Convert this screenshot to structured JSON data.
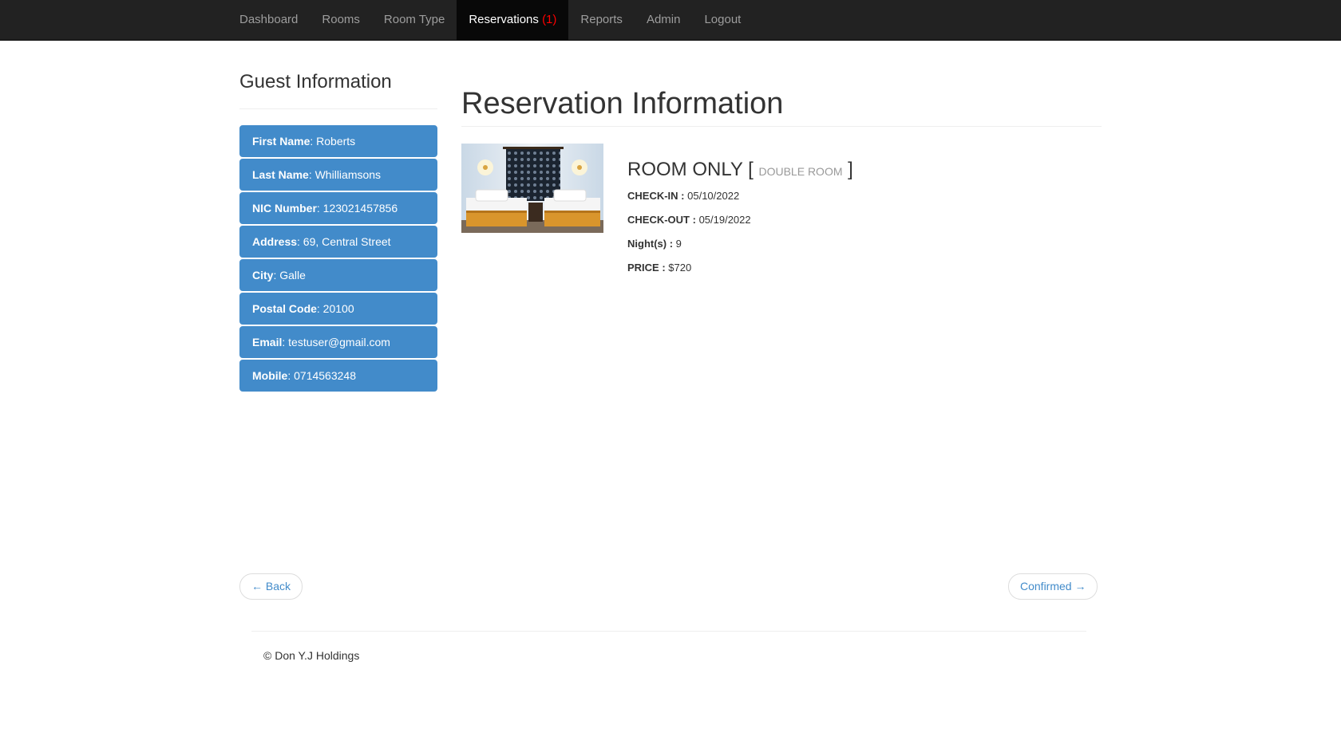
{
  "nav": {
    "items": [
      {
        "label": "Dashboard"
      },
      {
        "label": "Rooms"
      },
      {
        "label": "Room Type"
      },
      {
        "label": "Reservations ",
        "count": "(1)"
      },
      {
        "label": "Reports"
      },
      {
        "label": "Admin"
      },
      {
        "label": "Logout"
      }
    ]
  },
  "guest": {
    "title": "Guest Information",
    "fields": [
      {
        "label": "First Name",
        "value": ": Roberts"
      },
      {
        "label": "Last Name",
        "value": ": Whilliamsons"
      },
      {
        "label": "NIC Number",
        "value": ": 123021457856"
      },
      {
        "label": "Address",
        "value": ": 69, Central Street"
      },
      {
        "label": "City",
        "value": ": Galle"
      },
      {
        "label": "Postal Code",
        "value": ": 20100"
      },
      {
        "label": "Email",
        "value": ": testuser@gmail.com"
      },
      {
        "label": "Mobile",
        "value": ": 0714563248"
      }
    ]
  },
  "reservation": {
    "title": "Reservation Information",
    "room_name": "ROOM ONLY",
    "bracket_open": "[",
    "room_type": "DOUBLE ROOM",
    "bracket_close": "]",
    "checkin_label": "CHECK-IN :",
    "checkin_value": "05/10/2022",
    "checkout_label": "CHECK-OUT :",
    "checkout_value": "05/19/2022",
    "nights_label": "Night(s) :",
    "nights_value": "9",
    "price_label": "PRICE :",
    "price_value": "$720"
  },
  "pager": {
    "back_label": "← Back",
    "confirm_label": "Confirmed →"
  },
  "footer": {
    "text": "© Don Y.J Holdings"
  },
  "colors": {
    "navbar_bg": "#222222",
    "nav_active_bg": "#080808",
    "nav_count": "#ff0000",
    "list_item_bg": "#428bca",
    "link": "#428bca"
  }
}
